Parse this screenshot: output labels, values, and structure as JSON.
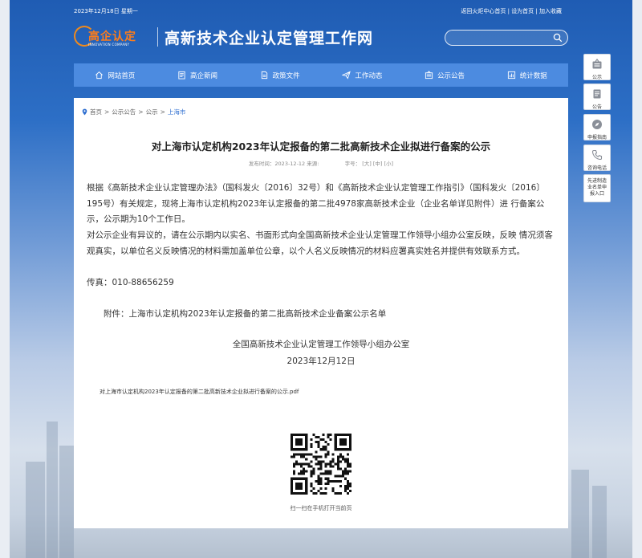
{
  "topbar": {
    "date": "2023年12月18日 星期一",
    "links": [
      "返回火炬中心首页",
      "设为首页",
      "加入收藏"
    ]
  },
  "header": {
    "logo_cn": "高企认定",
    "logo_en": "INNOVATION COMPANY",
    "site_title": "高新技术企业认定管理工作网",
    "search_placeholder": ""
  },
  "nav": {
    "items": [
      {
        "label": "网站首页",
        "icon": "home-icon"
      },
      {
        "label": "高企新闻",
        "icon": "news-icon"
      },
      {
        "label": "政策文件",
        "icon": "document-icon"
      },
      {
        "label": "工作动态",
        "icon": "paper-plane-icon"
      },
      {
        "label": "公示公告",
        "icon": "notice-icon"
      },
      {
        "label": "统计数据",
        "icon": "chart-icon"
      }
    ]
  },
  "breadcrumb": {
    "items": [
      "首页",
      "公示公告",
      "公示"
    ],
    "current": "上海市",
    "separator": ">"
  },
  "article": {
    "title": "对上海市认定机构2023年认定报备的第二批高新技术企业拟进行备案的公示",
    "publish_label": "发布时间：",
    "publish_date": "2023-12-12",
    "source_label": "来源:",
    "font_label": "字号：",
    "font_sizes": [
      "[大]",
      "[中]",
      "[小]"
    ],
    "para1": "根据《高新技术企业认定管理办法》（国科发火〔2016〕32号）和《高新技术企业认定管理工作指引》（国科发火〔2016〕195号）有关规定，现将上海市认定机构2023年认定报备的第二批4978家高新技术企业（企业名单详见附件）进 行备案公示，公示期为10个工作日。",
    "para2": "  对公示企业有异议的，请在公示期内以实名、书面形式向全国高新技术企业认定管理工作领导小组办公室反映，反映 情况须客观真实，以单位名义反映情况的材料需加盖单位公章，以个人名义反映情况的材料应署真实姓名并提供有效联系方式。",
    "fax": "传真：010-88656259",
    "attachment": "附件：上海市认定机构2023年认定报备的第二批高新技术企业备案公示名单",
    "signature_org": "全国高新技术企业认定管理工作领导小组办公室",
    "signature_date": "2023年12月12日",
    "pdf_link": "对上海市认定机构2023年认定报备的第二批高新技术企业拟进行备案的公示.pdf",
    "qr_caption": "扫一扫在手机打开当前页"
  },
  "side_panel": [
    {
      "label": "公示",
      "icon": "notice-board-icon"
    },
    {
      "label": "公告",
      "icon": "announcement-icon"
    },
    {
      "label": "申报指南",
      "icon": "compass-icon"
    },
    {
      "label": "咨询电话",
      "icon": "phone-icon"
    },
    {
      "label": "先进制造业名单申报入口",
      "icon": ""
    }
  ],
  "colors": {
    "nav_bg": "#4c8be0",
    "header_bg": "#1f5cb3",
    "link_current": "#2f6fd0",
    "logo_orange": "#ff7d1a"
  }
}
